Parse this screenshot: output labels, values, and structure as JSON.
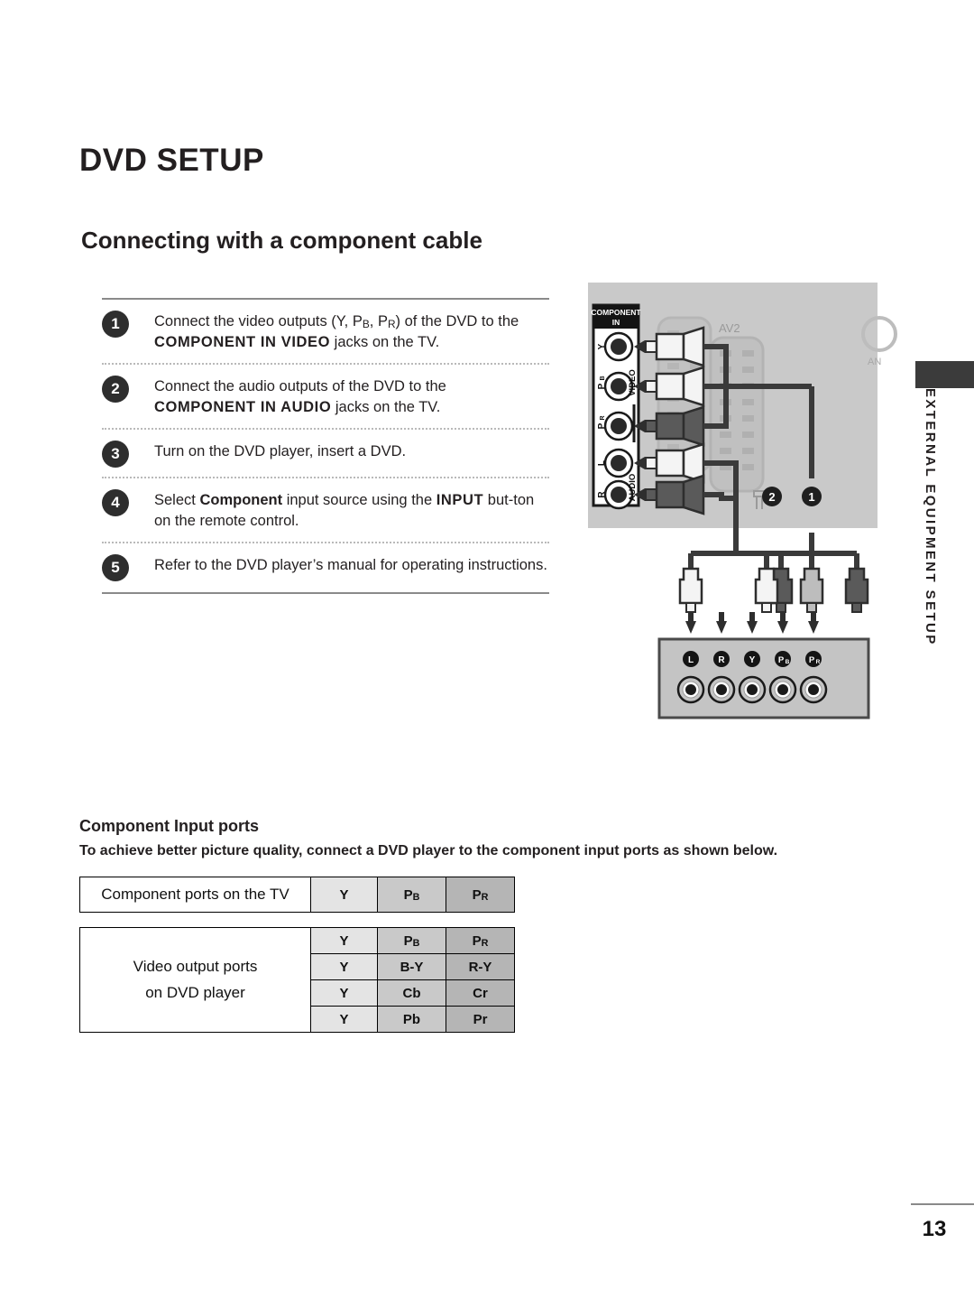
{
  "page": {
    "title": "DVD SETUP",
    "section_title": "Connecting with a component cable",
    "number": "13",
    "side_tab": "EXTERNAL EQUIPMENT SETUP"
  },
  "steps": [
    {
      "number": "1",
      "text_parts": [
        "Connect the video outputs (Y, P",
        "B",
        ", P",
        "R",
        ") of the DVD to the "
      ],
      "plain": "Connect the video outputs (Y, PB, PR) of the DVD to the ",
      "bold": "COMPONENT IN VIDEO",
      "tail": " jacks on the TV."
    },
    {
      "number": "2",
      "plain": "Connect the audio outputs of the DVD to the ",
      "bold": "COMPONENT IN AUDIO",
      "tail": " jacks on the TV."
    },
    {
      "number": "3",
      "plain": "Turn on the DVD player, insert a DVD.",
      "bold": "",
      "tail": ""
    },
    {
      "number": "4",
      "plain": "Select ",
      "bold": "Component",
      "mid": " input source using the ",
      "bold2": "INPUT",
      "tail": " but-ton on the remote control."
    },
    {
      "number": "5",
      "plain": "Refer to the DVD player’s manual for operating instructions.",
      "bold": "",
      "tail": ""
    }
  ],
  "diagram": {
    "tv_panel_label_header": "COMPONENT",
    "tv_panel_label_header2": "IN",
    "tv_group_video": "VIDEO",
    "tv_group_audio": "AUDIO",
    "tv_jacks": [
      "Y",
      "PB",
      "PR",
      "L",
      "R"
    ],
    "scart_label": "AV2",
    "antenna_label": "AN",
    "cable_badge_audio": "2",
    "cable_badge_video": "1",
    "dvd_jacks": [
      "L",
      "R",
      "Y",
      "PB",
      "PR"
    ],
    "colors": {
      "panel_gray": "#c9c9c9",
      "cable_dark": "#3a3a3a",
      "plug_white": "#f4f4f4",
      "plug_light": "#bdbdbd",
      "plug_dark": "#5a5a5a",
      "dvd_box": "#c4c4c4"
    }
  },
  "ports_section": {
    "heading": "Component Input ports",
    "description": "To achieve better picture quality, connect a DVD player to the component input ports as shown below.",
    "table_tv": {
      "row_label": "Component ports on the TV",
      "cells": [
        "Y",
        "PB",
        "PR"
      ]
    },
    "table_dvd": {
      "row_label_line1": "Video output ports",
      "row_label_line2": "on DVD player",
      "rows": [
        [
          "Y",
          "PB",
          "PR"
        ],
        [
          "Y",
          "B-Y",
          "R-Y"
        ],
        [
          "Y",
          "Cb",
          "Cr"
        ],
        [
          "Y",
          "Pb",
          "Pr"
        ]
      ]
    }
  }
}
